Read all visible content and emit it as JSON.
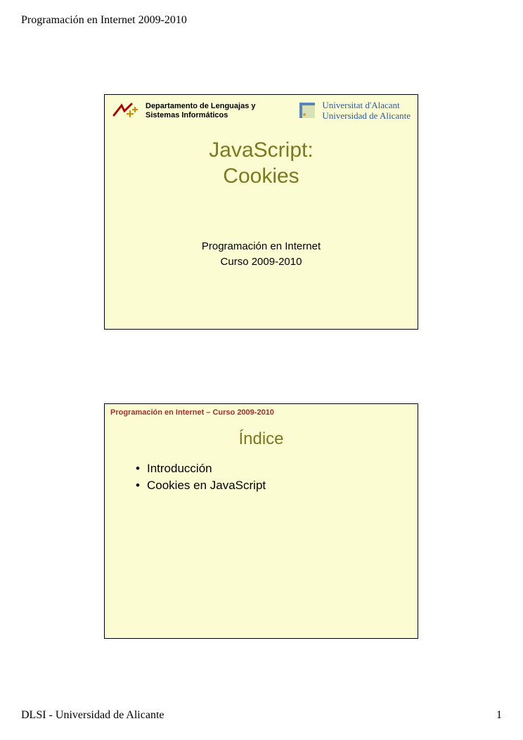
{
  "page": {
    "header": "Programación en Internet 2009-2010",
    "footer_left": "DLSI - Universidad de Alicante",
    "footer_right": "1"
  },
  "slide1": {
    "dept_line1": "Departamento de Lenguajas y",
    "dept_line2": "Sistemas Informáticos",
    "ua_line1": "Universitat d'Alacant",
    "ua_line2": "Universidad de Alicante",
    "title_line1": "JavaScript:",
    "title_line2": "Cookies",
    "sub_line1": "Programación en Internet",
    "sub_line2": "Curso 2009-2010"
  },
  "slide2": {
    "header": "Programación en Internet – Curso 2009-2010",
    "title": "Índice",
    "items": [
      "Introducción",
      "Cookies en JavaScript"
    ]
  }
}
